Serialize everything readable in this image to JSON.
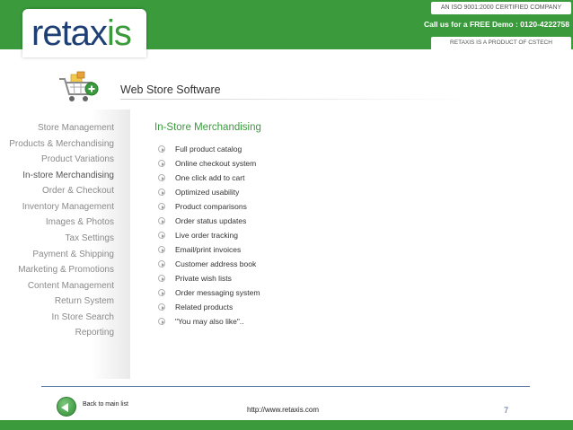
{
  "header": {
    "logo_main": "retax",
    "logo_x": "is",
    "iso_text": "AN ISO 9001:2000 CERTIFIED COMPANY",
    "demo_text": "Call us for a FREE Demo : 0120-4222758",
    "product_text": "RETAXIS IS A PRODUCT OF CSTECH",
    "color_brand": "#3a9a3c"
  },
  "page": {
    "title": "Web Store Software",
    "icon": "shopping-cart-add-icon"
  },
  "sidebar": {
    "items": [
      {
        "label": "Store Management"
      },
      {
        "label": "Products & Merchandising"
      },
      {
        "label": "Product Variations"
      },
      {
        "label": "In-store Merchandising"
      },
      {
        "label": "Order & Checkout"
      },
      {
        "label": "Inventory Management"
      },
      {
        "label": "Images & Photos"
      },
      {
        "label": "Tax Settings"
      },
      {
        "label": "Payment & Shipping"
      },
      {
        "label": "Marketing & Promotions"
      },
      {
        "label": "Content Management"
      },
      {
        "label": "Return System"
      },
      {
        "label": "In Store Search"
      },
      {
        "label": "Reporting"
      }
    ]
  },
  "main": {
    "section_title": "In-Store Merchandising",
    "features": [
      "Full product catalog",
      "Online checkout system",
      "One click add to cart",
      "Optimized usability",
      "Product comparisons",
      "Order status updates",
      "Live order tracking",
      "Email/print invoices",
      "Customer address book",
      "Private wish lists",
      "Order messaging system",
      "Related products",
      "\"You may also like\".."
    ]
  },
  "footer": {
    "back_label": "Back to main list",
    "url": "http://www.retaxis.com",
    "page_number": "7"
  }
}
